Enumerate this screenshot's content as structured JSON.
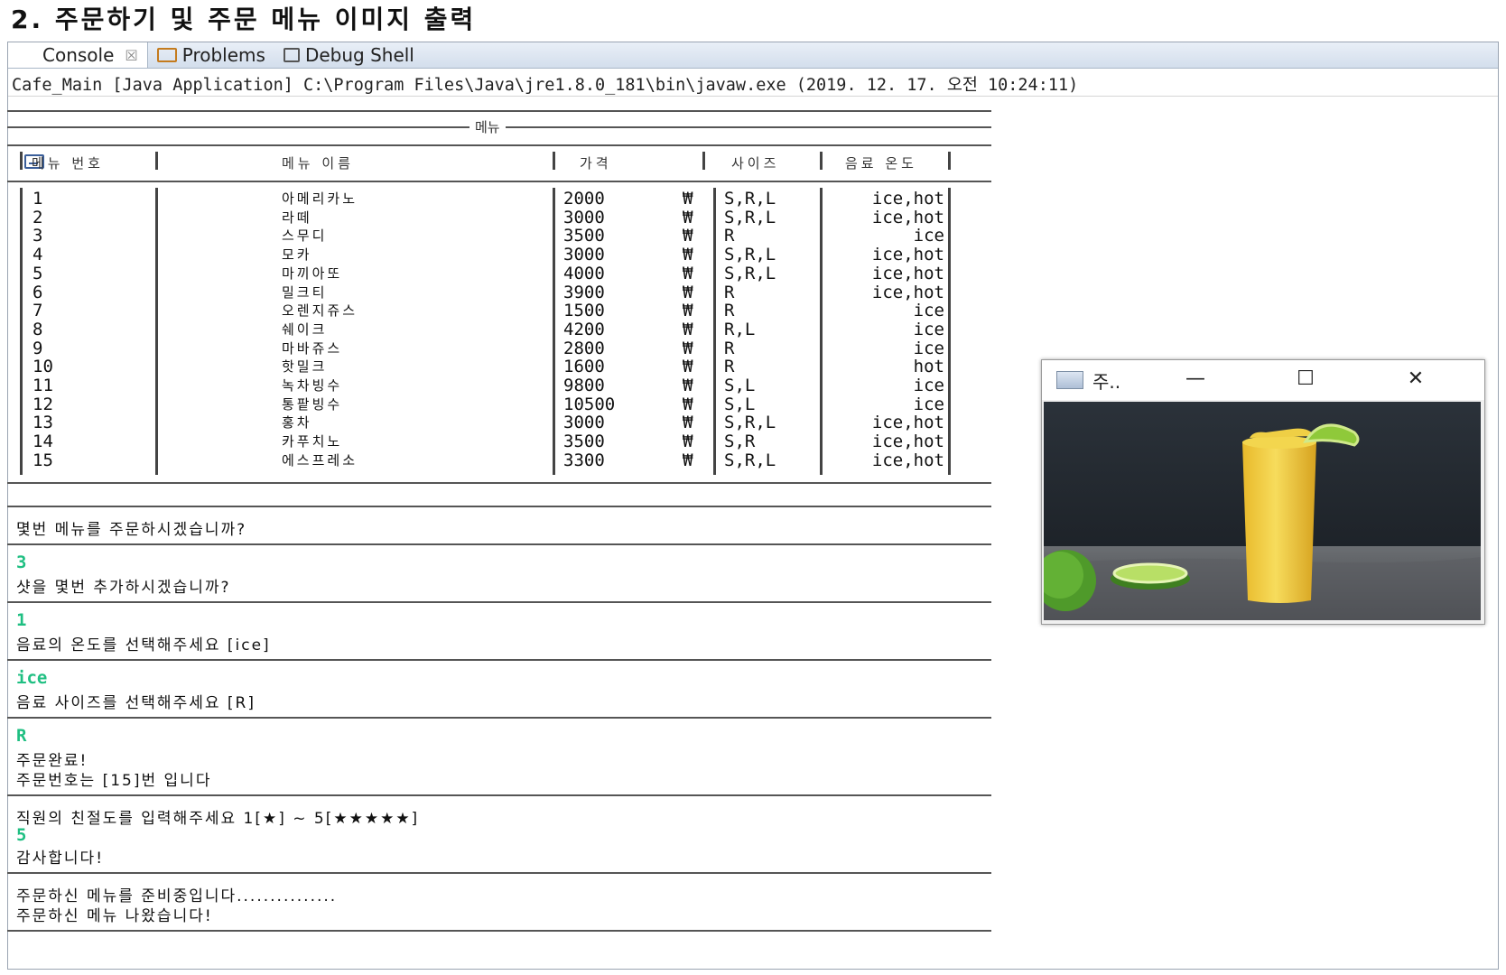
{
  "heading": "2. 주문하기 및 주문 메뉴 이미지 출력",
  "tabs": [
    {
      "label": "Console",
      "icon": "console-icon",
      "close": "☒"
    },
    {
      "label": "Problems",
      "icon": "problems-icon"
    },
    {
      "label": "Debug Shell",
      "icon": "debug-shell-icon"
    }
  ],
  "launch_line": "Cafe_Main [Java Application] C:\\Program Files\\Java\\jre1.8.0_181\\bin\\javaw.exe (2019. 12. 17. 오전 10:24:11)",
  "menu": {
    "title": "메뉴",
    "headers": {
      "no": "메뉴 번호",
      "name": "메뉴 이름",
      "price": "가격",
      "size": "사이즈",
      "temp": "음료 온도"
    },
    "currency": "₩",
    "rows": [
      {
        "no": "1",
        "name": "아메리카노",
        "price": "2000",
        "size": "S,R,L",
        "temp": "ice,hot"
      },
      {
        "no": "2",
        "name": "라떼",
        "price": "3000",
        "size": "S,R,L",
        "temp": "ice,hot"
      },
      {
        "no": "3",
        "name": "스무디",
        "price": "3500",
        "size": "R",
        "temp": "ice"
      },
      {
        "no": "4",
        "name": "모카",
        "price": "3000",
        "size": "S,R,L",
        "temp": "ice,hot"
      },
      {
        "no": "5",
        "name": "마끼아또",
        "price": "4000",
        "size": "S,R,L",
        "temp": "ice,hot"
      },
      {
        "no": "6",
        "name": "밀크티",
        "price": "3900",
        "size": "R",
        "temp": "ice,hot"
      },
      {
        "no": "7",
        "name": "오렌지쥬스",
        "price": "1500",
        "size": "R",
        "temp": "ice"
      },
      {
        "no": "8",
        "name": "쉐이크",
        "price": "4200",
        "size": "R,L",
        "temp": "ice"
      },
      {
        "no": "9",
        "name": "마바쥬스",
        "price": "2800",
        "size": "R",
        "temp": "ice"
      },
      {
        "no": "10",
        "name": "핫밀크",
        "price": "1600",
        "size": "R",
        "temp": "hot"
      },
      {
        "no": "11",
        "name": "녹차빙수",
        "price": "9800",
        "size": "S,L",
        "temp": "ice"
      },
      {
        "no": "12",
        "name": "통팥빙수",
        "price": "10500",
        "size": "S,L",
        "temp": "ice"
      },
      {
        "no": "13",
        "name": "홍차",
        "price": "3000",
        "size": "S,R,L",
        "temp": "ice,hot"
      },
      {
        "no": "14",
        "name": "카푸치노",
        "price": "3500",
        "size": "S,R",
        "temp": "ice,hot"
      },
      {
        "no": "15",
        "name": "에스프레소",
        "price": "3300",
        "size": "S,R,L",
        "temp": "ice,hot"
      }
    ]
  },
  "dialog": {
    "q_menu": "몇번 메뉴를 주문하시겠습니까?",
    "a_menu": "3",
    "q_shot": "샷을 몇번 추가하시겠습니까?",
    "a_shot": "1",
    "q_temp": "음료의 온도를 선택해주세요 [ice]",
    "a_temp": "ice",
    "q_size": "음료 사이즈를 선택해주세요 [R]",
    "a_size": "R",
    "done": "주문완료!",
    "order_no": "주문번호는 [15]번 입니다",
    "q_rating": "직원의 친절도를 입력해주세요 1[★] ~ 5[★★★★★]",
    "a_rating": "5",
    "thanks": "감사합니다!",
    "preparing": "주문하신 메뉴를 준비중입니다...............",
    "ready": "주문하신 메뉴 나왔습니다!"
  },
  "image_window": {
    "title": "주..",
    "minimize": "—",
    "maximize": "☐",
    "close": "✕"
  },
  "colors": {
    "input": "#1fbf82",
    "tabbar": "#d3deec"
  }
}
